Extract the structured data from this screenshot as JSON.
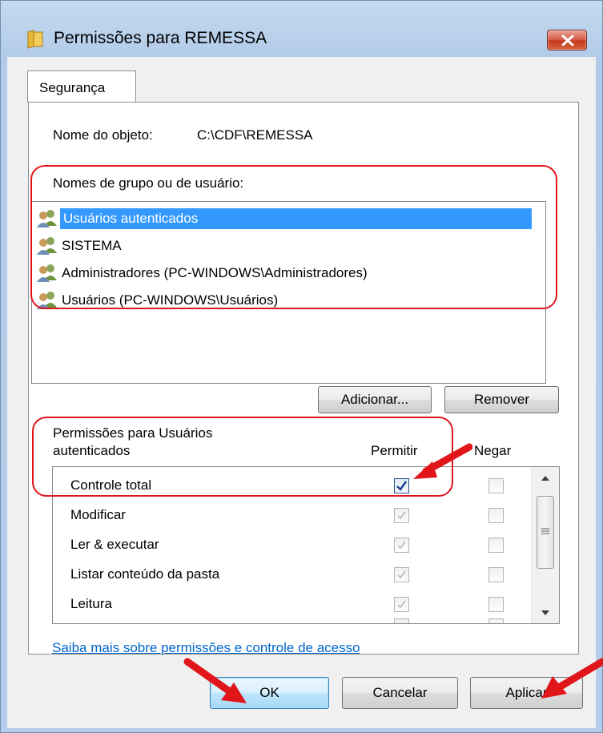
{
  "window": {
    "title": "Permissões para REMESSA",
    "close_symbol": "✕"
  },
  "tabs": [
    {
      "label": "Segurança",
      "active": true
    }
  ],
  "object": {
    "label": "Nome do objeto:",
    "value": "C:\\CDF\\REMESSA"
  },
  "groups": {
    "label": "Nomes de grupo ou de usuário:",
    "items": [
      {
        "name": "Usuários autenticados",
        "selected": true,
        "icon": "users-group-icon"
      },
      {
        "name": "SISTEMA",
        "selected": false,
        "icon": "users-group-icon"
      },
      {
        "name": "Administradores (PC-WINDOWS\\Administradores)",
        "selected": false,
        "icon": "users-group-icon"
      },
      {
        "name": "Usuários (PC-WINDOWS\\Usuários)",
        "selected": false,
        "icon": "users-group-icon"
      }
    ],
    "add_button": "Adicionar...",
    "remove_button": "Remover"
  },
  "permissions": {
    "title_line1": "Permissões para Usuários",
    "title_line2": "autenticados",
    "allow_header": "Permitir",
    "deny_header": "Negar",
    "rows": [
      {
        "name": "Controle total",
        "allow": true,
        "allow_enabled": true,
        "deny": false
      },
      {
        "name": "Modificar",
        "allow": true,
        "allow_enabled": false,
        "deny": false
      },
      {
        "name": "Ler & executar",
        "allow": true,
        "allow_enabled": false,
        "deny": false
      },
      {
        "name": "Listar conteúdo da pasta",
        "allow": true,
        "allow_enabled": false,
        "deny": false
      },
      {
        "name": "Leitura",
        "allow": true,
        "allow_enabled": false,
        "deny": false
      }
    ]
  },
  "link": "Saiba mais sobre permissões e controle de acesso",
  "footer": {
    "ok": "OK",
    "cancel": "Cancelar",
    "apply": "Aplicar"
  },
  "colors": {
    "annotation": "#e0161b",
    "selection": "#3399ff",
    "link": "#0066cc"
  }
}
